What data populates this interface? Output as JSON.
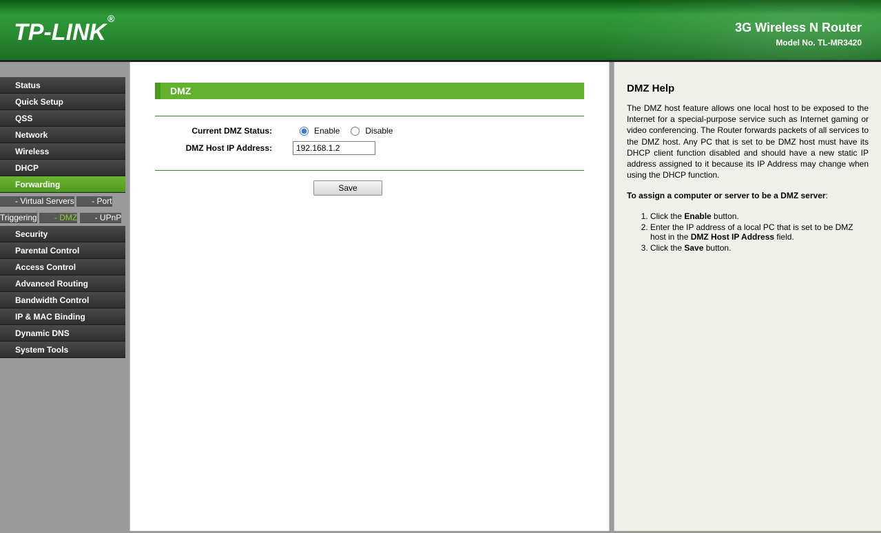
{
  "header": {
    "brand": "TP-LINK",
    "reg": "®",
    "product": "3G Wireless N Router",
    "model": "Model No. TL-MR3420"
  },
  "sidebar": {
    "items": [
      {
        "label": "Status"
      },
      {
        "label": "Quick Setup"
      },
      {
        "label": "QSS"
      },
      {
        "label": "Network"
      },
      {
        "label": "Wireless"
      },
      {
        "label": "DHCP"
      },
      {
        "label": "Forwarding",
        "active": true,
        "subs": [
          {
            "label": "- Virtual Servers"
          },
          {
            "label": "- Port Triggering"
          },
          {
            "label": "- DMZ",
            "current": true
          },
          {
            "label": "- UPnP"
          }
        ]
      },
      {
        "label": "Security"
      },
      {
        "label": "Parental Control"
      },
      {
        "label": "Access Control"
      },
      {
        "label": "Advanced Routing"
      },
      {
        "label": "Bandwidth Control"
      },
      {
        "label": "IP & MAC Binding"
      },
      {
        "label": "Dynamic DNS"
      },
      {
        "label": "System Tools"
      }
    ]
  },
  "main": {
    "title": "DMZ",
    "status_label": "Current DMZ Status:",
    "enable_label": "Enable",
    "disable_label": "Disable",
    "status_selected": "enable",
    "ip_label": "DMZ Host IP Address:",
    "ip_value": "192.168.1.2",
    "save_label": "Save"
  },
  "help": {
    "title": "DMZ Help",
    "intro": "The DMZ host feature allows one local host to be exposed to the Internet for a special-purpose service such as Internet gaming or video conferencing. The Router forwards packets of all services to the DMZ host. Any PC that is set to be DMZ host must have its DHCP client function disabled and should have a new static IP address assigned to it because its IP Address may change when using the DHCP function.",
    "assign_label": "To assign a computer or server to be a DMZ server",
    "step1_a": "Click the ",
    "step1_b": "Enable",
    "step1_c": " button.",
    "step2_a": "Enter the IP address of a local PC that is set to be DMZ host in the ",
    "step2_b": "DMZ Host IP Address",
    "step2_c": " field.",
    "step3_a": "Click the ",
    "step3_b": "Save",
    "step3_c": " button."
  }
}
